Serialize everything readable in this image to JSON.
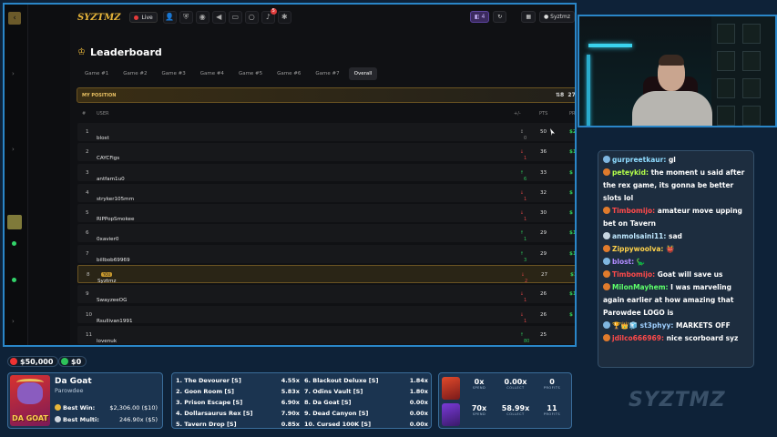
{
  "header": {
    "logo": "SYZTMZ",
    "live_label": "Live",
    "notification_count": "5",
    "chip_count": "4",
    "username": "Syztmz"
  },
  "leaderboard": {
    "title": "Leaderboard",
    "tabs": [
      "Game #1",
      "Game #2",
      "Game #3",
      "Game #4",
      "Game #5",
      "Game #6",
      "Game #7",
      "Overall"
    ],
    "active_tab": "Overall",
    "my_position_label": "MY POSITION",
    "my_position_value": "8",
    "my_position_points": "27",
    "columns": {
      "rank": "#",
      "user": "USER",
      "delta": "+/-",
      "points": "PTS",
      "prize": "PRI"
    },
    "rows": [
      {
        "rank": "1",
        "user": "blost",
        "delta": "0",
        "trend": "nc",
        "points": "50",
        "prize": "$2"
      },
      {
        "rank": "2",
        "user": "CAYCFigs",
        "delta": "1",
        "trend": "dn",
        "points": "36",
        "prize": "$1"
      },
      {
        "rank": "3",
        "user": "antfam1u0",
        "delta": "6",
        "trend": "up",
        "points": "33",
        "prize": "$"
      },
      {
        "rank": "4",
        "user": "stryker105mm",
        "delta": "1",
        "trend": "dn",
        "points": "32",
        "prize": "$"
      },
      {
        "rank": "5",
        "user": "RIPPopSmokee",
        "delta": "1",
        "trend": "dn",
        "points": "30",
        "prize": "$"
      },
      {
        "rank": "6",
        "user": "0xavier0",
        "delta": "1",
        "trend": "up",
        "points": "29",
        "prize": "$1"
      },
      {
        "rank": "7",
        "user": "billbob69969",
        "delta": "3",
        "trend": "up",
        "points": "29",
        "prize": "$1"
      },
      {
        "rank": "8",
        "user": "Syztmz",
        "delta": "2",
        "trend": "dn",
        "points": "27",
        "prize": "$1",
        "me": true,
        "tag": "YOU"
      },
      {
        "rank": "9",
        "user": "SwayzeeOG",
        "delta": "1",
        "trend": "dn",
        "points": "26",
        "prize": "$1"
      },
      {
        "rank": "10",
        "user": "Rsullivan1991",
        "delta": "1",
        "trend": "dn",
        "points": "26",
        "prize": "$"
      },
      {
        "rank": "11",
        "user": "lovenuk",
        "delta": "80",
        "trend": "up",
        "points": "25",
        "prize": ""
      }
    ]
  },
  "chat": {
    "messages": [
      {
        "user": "gurpreetkaur:",
        "text": " gl",
        "color": "#8fdcff",
        "icon": "#7fb6e0"
      },
      {
        "user": "peteykid:",
        "text": " the moment u said after the rex game, its gonna be better slots lol",
        "color": "#b4ff4a",
        "icon": "#e07b2c"
      },
      {
        "user": "Timbomijo:",
        "text": " amateur move upping bet on Tavern",
        "color": "#ff4a4a",
        "icon": "#e07b2c"
      },
      {
        "user": "anmolsaini11:",
        "text": " sad",
        "color": "#bfe8ff",
        "icon": "#c6d4e0"
      },
      {
        "user": "Zippywoolva:",
        "text": " 👹",
        "color": "#ffd24a",
        "icon": "#e07b2c"
      },
      {
        "user": "blost:",
        "text": " 🦕",
        "color": "#b28cff",
        "icon": "#7fb6e0"
      },
      {
        "user": "Timbomijo:",
        "text": " Goat will save us",
        "color": "#ff4a4a",
        "icon": "#e07b2c"
      },
      {
        "user": "MilonMayhem:",
        "text": " I was marveling again earlier at how amazing that Parowdee LOGO is",
        "color": "#5dff6a",
        "icon": "#e07b2c"
      },
      {
        "user": "🏆👑🧊 st3phyy:",
        "text": " MARKETS OFF",
        "color": "#9fd0ff",
        "icon": "#7fb6e0"
      },
      {
        "user": "jdilco666969:",
        "text": " nice scorboard syz",
        "color": "#ff4a4a",
        "icon": "#e07b2c"
      }
    ]
  },
  "balances": {
    "primary": "$50,000",
    "secondary": "$0"
  },
  "slot": {
    "art_text": "DA GOAT",
    "name": "Da Goat",
    "provider": "Parowdee",
    "best_win_label": "Best Win:",
    "best_win_value": "$2,306.00 ($10)",
    "best_multi_label": "Best Multi:",
    "best_multi_value": "246.90x ($5)"
  },
  "top_games": [
    {
      "label": "1.  The Devourer [S]",
      "multi": "4.55x"
    },
    {
      "label": "2.  Goon Room [S]",
      "multi": "5.83x"
    },
    {
      "label": "3.  Prison Escape [S]",
      "multi": "6.90x"
    },
    {
      "label": "4.  Dollarsaurus Rex [S]",
      "multi": "7.90x"
    },
    {
      "label": "5.  Tavern Drop [S]",
      "multi": "0.85x"
    },
    {
      "label": "6.  Blackout Deluxe [S]",
      "multi": "1.84x"
    },
    {
      "label": "7.  Odins Vault [S]",
      "multi": "1.80x"
    },
    {
      "label": "8.  Da Goat [S]",
      "multi": "0.00x"
    },
    {
      "label": "9.  Dead Canyon [S]",
      "multi": "0.00x"
    },
    {
      "label": "10.  Cursed 100K [S]",
      "multi": "0.00x"
    }
  ],
  "bonus_stats": {
    "keys": {
      "spend": "SPEND",
      "collect": "COLLECT",
      "profits": "PROFITS"
    },
    "rows": [
      {
        "spend": "0x",
        "collect": "0.00x",
        "profits": "0"
      },
      {
        "spend": "70x",
        "collect": "58.99x",
        "profits": "11"
      }
    ]
  },
  "watermark": "SYZTMZ"
}
